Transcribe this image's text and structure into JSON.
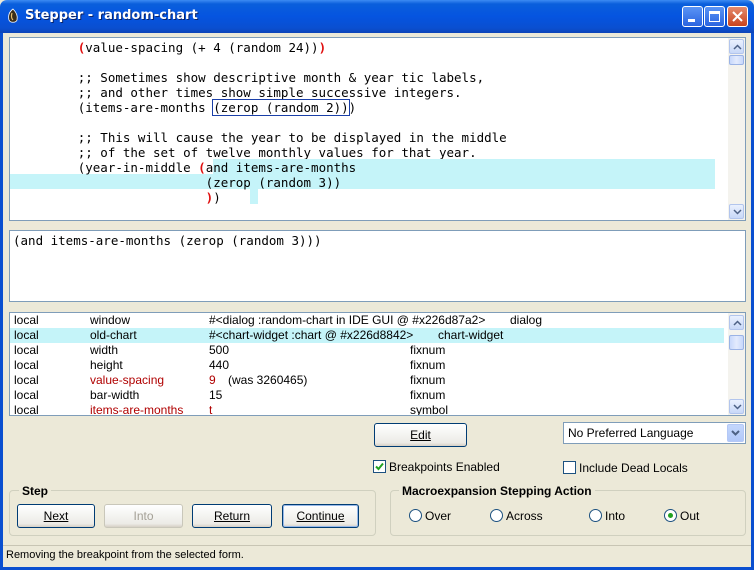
{
  "window": {
    "title": "Stepper - random-chart"
  },
  "code": {
    "lines": [
      {
        "indent": "         ",
        "open": "(",
        "text": "value-spacing (+ 4 (random 24))",
        "close": ")"
      },
      {
        "text": ""
      },
      {
        "text": "         ;; Sometimes show descriptive month & year tic labels,"
      },
      {
        "text": "         ;; and other times show simple successive integers."
      },
      {
        "pre": "         (items-are-months ",
        "boxed": "(zerop (random 2))",
        "post": ")"
      },
      {
        "text": ""
      },
      {
        "text": "         ;; This will cause the year to be displayed in the middle"
      },
      {
        "text": "         ;; of the set of twelve monthly values for that year."
      },
      {
        "pre": "         (year-in-middle ",
        "open": "(",
        "text": "and items-are-months"
      },
      {
        "text": "                          (zerop (random 3))"
      },
      {
        "indent": "                          ",
        "close": ")",
        "text": ")"
      }
    ]
  },
  "form_pane": {
    "text": "(and items-are-months (zerop (random 3)))"
  },
  "locals": {
    "rows": [
      {
        "scope": "local",
        "name": "window",
        "value": "#<dialog :random-chart in IDE GUI @ #x226d87a2>",
        "was": "",
        "type": "dialog",
        "changed": false,
        "selected": false
      },
      {
        "scope": "local",
        "name": "old-chart",
        "value": "#<chart-widget :chart @ #x226d8842>",
        "was": "",
        "type": "chart-widget",
        "changed": false,
        "selected": true
      },
      {
        "scope": "local",
        "name": "width",
        "value": "500",
        "was": "",
        "type": "fixnum",
        "changed": false,
        "selected": false
      },
      {
        "scope": "local",
        "name": "height",
        "value": "440",
        "was": "",
        "type": "fixnum",
        "changed": false,
        "selected": false
      },
      {
        "scope": "local",
        "name": "value-spacing",
        "value": "9",
        "was": "(was 3260465)",
        "type": "fixnum",
        "changed": true,
        "selected": false
      },
      {
        "scope": "local",
        "name": "bar-width",
        "value": "15",
        "was": "",
        "type": "fixnum",
        "changed": false,
        "selected": false
      },
      {
        "scope": "local",
        "name": "items-are-months",
        "value": "t",
        "was": "",
        "type": "symbol",
        "changed": true,
        "selected": false
      }
    ]
  },
  "controls": {
    "edit_label": "Edit",
    "language_select": "No Preferred Language",
    "breakpoints_enabled_label": "Breakpoints Enabled",
    "breakpoints_enabled_checked": true,
    "include_dead_locals_label": "Include Dead Locals",
    "include_dead_locals_checked": false
  },
  "step_group": {
    "title": "Step",
    "next_label": "Next",
    "into_label": "Into",
    "return_label": "Return",
    "continue_label": "Continue"
  },
  "macro_group": {
    "title": "Macroexpansion Stepping Action",
    "options": [
      {
        "label": "Over",
        "selected": false
      },
      {
        "label": "Across",
        "selected": false
      },
      {
        "label": "Into",
        "selected": false
      },
      {
        "label": "Out",
        "selected": true
      }
    ]
  },
  "status": {
    "text": "Removing the breakpoint from the selected form."
  },
  "icons": {
    "app": "lisp-app-icon",
    "minimize": "minimize-icon",
    "maximize": "maximize-icon",
    "close": "close-icon"
  },
  "colors": {
    "highlight": "#c5f4f9",
    "paren": "#e01010",
    "changed_local": "#b00000",
    "titlebar": "#0554e0"
  }
}
